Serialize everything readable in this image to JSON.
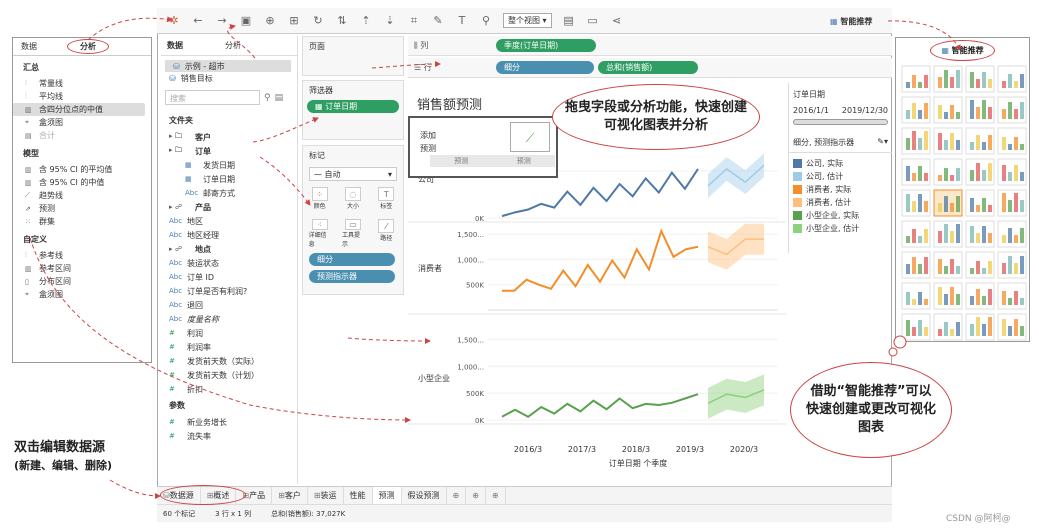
{
  "left_panel": {
    "tabs": [
      "数据",
      "分析"
    ],
    "sections": [
      {
        "title": "汇总",
        "items": [
          {
            "label": "常量线",
            "icon": "reference-line-icon",
            "state": "normal"
          },
          {
            "label": "平均线",
            "icon": "reference-line-icon",
            "state": "normal"
          },
          {
            "label": "含四分位点的中值",
            "icon": "band-icon",
            "state": "highlighted"
          },
          {
            "label": "盒须图",
            "icon": "box-plot-icon",
            "state": "normal"
          },
          {
            "label": "合计",
            "icon": "sum-icon",
            "state": "disabled"
          }
        ]
      },
      {
        "title": "模型",
        "items": [
          {
            "label": "含 95% CI 的平均值",
            "icon": "band-icon",
            "state": "normal"
          },
          {
            "label": "含 95% CI 的中值",
            "icon": "band-icon",
            "state": "normal"
          },
          {
            "label": "趋势线",
            "icon": "trend-icon",
            "state": "normal"
          },
          {
            "label": "预测",
            "icon": "forecast-icon",
            "state": "normal"
          },
          {
            "label": "群集",
            "icon": "cluster-icon",
            "state": "normal"
          }
        ]
      },
      {
        "title": "自定义",
        "items": [
          {
            "label": "参考线",
            "icon": "reference-line-icon",
            "state": "normal"
          },
          {
            "label": "参考区间",
            "icon": "band-icon",
            "state": "normal"
          },
          {
            "label": "分布区间",
            "icon": "distribution-icon",
            "state": "normal"
          },
          {
            "label": "盒须图",
            "icon": "box-plot-icon",
            "state": "normal"
          }
        ]
      }
    ]
  },
  "toolbar": {
    "view_select": "整个视图",
    "smart_label": "智能推荐"
  },
  "data_pane": {
    "tabs": [
      "数据",
      "分析"
    ],
    "sources": [
      "示例 - 超市",
      "销售目标"
    ],
    "search_placeholder": "搜索",
    "tables_title": "文件夹",
    "folders": [
      {
        "label": "客户",
        "kind": "folder",
        "indent": 0
      },
      {
        "label": "订单",
        "kind": "folder",
        "indent": 0
      },
      {
        "label": "发货日期",
        "kind": "date",
        "indent": 1
      },
      {
        "label": "订单日期",
        "kind": "date",
        "indent": 1
      },
      {
        "label": "邮寄方式",
        "kind": "abc",
        "indent": 1
      },
      {
        "label": "产品",
        "kind": "group",
        "indent": 0
      },
      {
        "label": "地区",
        "kind": "abc",
        "indent": 0
      },
      {
        "label": "地区经理",
        "kind": "abc",
        "indent": 0
      },
      {
        "label": "地点",
        "kind": "group",
        "indent": 0
      },
      {
        "label": "装运状态",
        "kind": "abc",
        "indent": 0
      },
      {
        "label": "订单 ID",
        "kind": "abc",
        "indent": 0
      },
      {
        "label": "订单是否有利润?",
        "kind": "abc",
        "indent": 0
      },
      {
        "label": "退回",
        "kind": "abc",
        "indent": 0
      },
      {
        "label": "度量名称",
        "kind": "abc",
        "indent": 0
      },
      {
        "label": "利润",
        "kind": "measure",
        "indent": 0
      },
      {
        "label": "利润率",
        "kind": "measure",
        "indent": 0
      },
      {
        "label": "发货前天数（实际）",
        "kind": "measure",
        "indent": 0
      },
      {
        "label": "发货前天数（计划）",
        "kind": "measure",
        "indent": 0
      },
      {
        "label": "折扣",
        "kind": "measure",
        "indent": 0
      }
    ],
    "params_title": "参数",
    "params": [
      "新业务增长",
      "流失率"
    ]
  },
  "cards": {
    "pages_title": "页面",
    "filters_title": "筛选器",
    "filter_pill": "订单日期",
    "marks_title": "标记",
    "marks_type": "自动",
    "mark_buttons": [
      "颜色",
      "大小",
      "标签",
      "详细信息",
      "工具提示",
      "路径"
    ],
    "mark_pills": [
      "细分",
      "预测指示器"
    ]
  },
  "shelves": {
    "columns_label": "列",
    "columns_pill": "季度(订单日期)",
    "rows_label": "行",
    "rows_pills": [
      "细分",
      "总和(销售额)"
    ]
  },
  "view": {
    "title": "销售额预测",
    "popup": {
      "line1": "添加",
      "line2": "预测",
      "tag1": "预测",
      "tag2": "预测"
    },
    "x_axis_title": "订单日期 个季度"
  },
  "chart_data": {
    "type": "line",
    "facets": [
      "公司",
      "消费者",
      "小型企业"
    ],
    "x_ticks": [
      "2016/3",
      "2017/3",
      "2018/3",
      "2019/3",
      "2020/3"
    ],
    "facet_ticks": [
      [
        "0K",
        "500K"
      ],
      [
        "500K",
        "1,000...",
        "1,500..."
      ],
      [
        "0K",
        "500K",
        "1,000...",
        "1,500..."
      ]
    ],
    "series": [
      {
        "name": "公司, 实际",
        "facet": "公司",
        "values": [
          20,
          60,
          90,
          150,
          110,
          280,
          140,
          320,
          180,
          360,
          230,
          420,
          270,
          480,
          310,
          520
        ]
      },
      {
        "name": "公司, 估计",
        "facet": "公司",
        "values": [
          340,
          520,
          380,
          560
        ]
      },
      {
        "name": "消费者, 实际",
        "facet": "消费者",
        "values": [
          380,
          380,
          600,
          500,
          420,
          780,
          470,
          890,
          560,
          980,
          640,
          1200,
          800,
          1560,
          1050,
          1200,
          1250
        ]
      },
      {
        "name": "消费者, 估计",
        "facet": "消费者",
        "values": [
          1250,
          1100,
          1400,
          1400
        ]
      },
      {
        "name": "小型企业, 实际",
        "facet": "小型企业",
        "values": [
          60,
          190,
          60,
          240,
          120,
          300,
          160,
          360,
          200,
          400,
          220,
          300,
          280,
          320,
          400,
          480
        ]
      },
      {
        "name": "小型企业, 估计",
        "facet": "小型企业",
        "values": [
          310,
          480,
          420,
          560
        ]
      }
    ]
  },
  "legend": {
    "date_title": "订单日期",
    "date_from": "2016/1/1",
    "date_to": "2019/12/30",
    "title": "细分, 预测指示器",
    "items": [
      {
        "label": "公司, 实际",
        "color": "#4e79a7"
      },
      {
        "label": "公司, 估计",
        "color": "#a0cbe8"
      },
      {
        "label": "消费者, 实际",
        "color": "#f28e2b"
      },
      {
        "label": "消费者, 估计",
        "color": "#ffbe7d"
      },
      {
        "label": "小型企业, 实际",
        "color": "#59a14f"
      },
      {
        "label": "小型企业, 估计",
        "color": "#8cd17d"
      }
    ]
  },
  "bottom_tabs": [
    "数据源",
    "概述",
    "产品",
    "客户",
    "装运",
    "性能",
    "预测",
    "假设预测"
  ],
  "active_tab": "预测",
  "status": {
    "marks": "60 个标记",
    "rows_cols": "3 行 x 1 列",
    "sum": "总和(销售额): 37,027K"
  },
  "gallery": {
    "title": "智能推荐"
  },
  "annotations": {
    "top_cloud": "拖曳字段或分析功能，快速创建可视化图表并分析",
    "right_cloud": "借助“智能推荐”可以快速创建或更改可视化图表",
    "bottom_left_1": "双击编辑数据源",
    "bottom_left_2": "(新建、编辑、删除)"
  },
  "watermark": "CSDN @阿柯@"
}
